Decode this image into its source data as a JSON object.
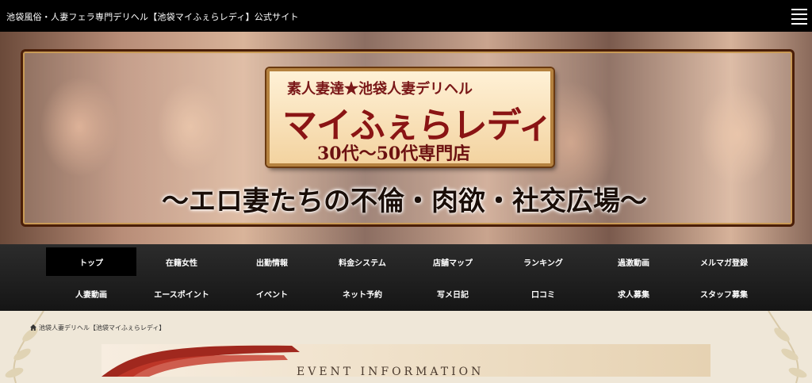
{
  "header": {
    "site_title": "池袋風俗・人妻フェラ専門デリヘル【池袋マイふぇらレディ】公式サイト",
    "menu_icon": "hamburger-menu-icon"
  },
  "hero": {
    "logo_top": "素人妻達★池袋人妻デリヘル",
    "logo_main": "マイふぇらレディ",
    "logo_sub": "30代～50代専門店",
    "tagline": "～エロ妻たちの不倫・肉欲・社交広場～"
  },
  "nav": {
    "row1": [
      {
        "label": "トップ",
        "active": true
      },
      {
        "label": "在籍女性"
      },
      {
        "label": "出勤情報"
      },
      {
        "label": "料金システム"
      },
      {
        "label": "店舗マップ"
      },
      {
        "label": "ランキング"
      },
      {
        "label": "過激動画"
      },
      {
        "label": "メルマガ登録"
      }
    ],
    "row2": [
      {
        "label": "人妻動画"
      },
      {
        "label": "エースポイント"
      },
      {
        "label": "イベント"
      },
      {
        "label": "ネット予約"
      },
      {
        "label": "写メ日記"
      },
      {
        "label": "口コミ"
      },
      {
        "label": "求人募集"
      },
      {
        "label": "スタッフ募集"
      }
    ]
  },
  "breadcrumb": {
    "icon": "home-icon",
    "text": "池袋人妻デリヘル【池袋マイふぇらレディ】"
  },
  "event": {
    "title": "EVENT INFORMATION"
  },
  "colors": {
    "nav_bg": "#1e1e1e",
    "logo_red": "#8a1414",
    "frame_brown": "#4a1e08"
  }
}
